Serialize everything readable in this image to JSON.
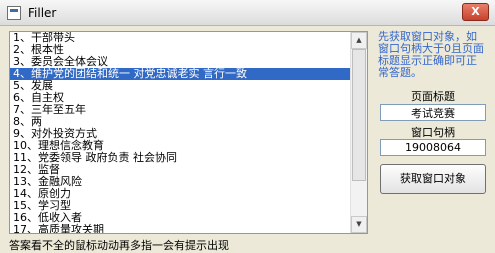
{
  "window": {
    "title": "Filler",
    "close_label": "X"
  },
  "list": {
    "selected_index": 3,
    "items": [
      "1、干部带头",
      "2、根本性",
      "3、委员会全体会议",
      "4、维护党的团结和统一 对党忠诚老实 言行一致",
      "5、发展",
      "6、自主权",
      "7、三年至五年",
      "8、两",
      "9、对外投资方式",
      "10、理想信念教育",
      "11、党委领导 政府负责 社会协同",
      "12、监督",
      "13、金融风险",
      "14、原创力",
      "15、学习型",
      "16、低收入者",
      "17、高质量攻关期"
    ]
  },
  "side": {
    "hint": "先获取窗口对象，如窗口句柄大于0且页面标题显示正确即可正常答题。",
    "page_title_label": "页面标题",
    "page_title_value": "考试竞赛",
    "handle_label": "窗口句柄",
    "handle_value": "19008064",
    "get_window_button": "获取窗口对象"
  },
  "status": {
    "text": "答案看不全的鼠标动动再多指一会有提示出现"
  }
}
